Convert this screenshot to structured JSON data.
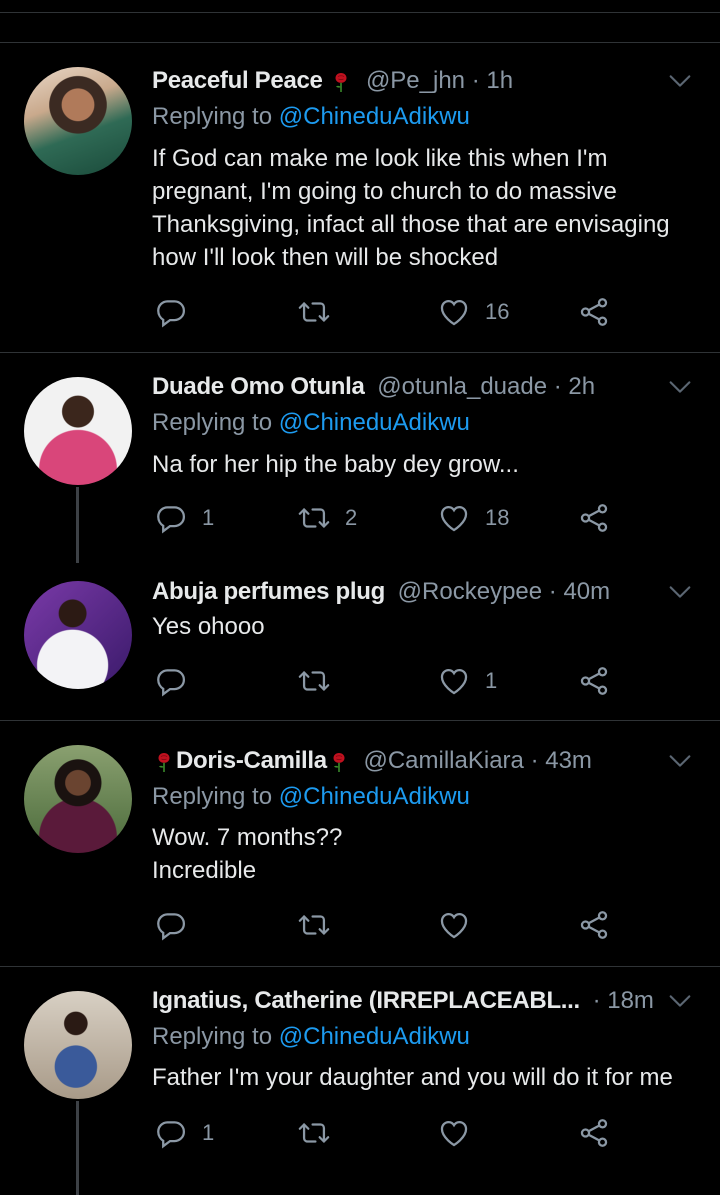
{
  "reply_prefix": "Replying to ",
  "tweets": [
    {
      "name": "Peaceful Peace",
      "handle": "@Pe_jhn",
      "time": "· 1h",
      "reply_to": "@ChineduAdikwu",
      "text": "If God can make me look like this when I'm\npregnant, I'm going to church to do massive\nThanksgiving, infact all those that are envisaging\nhow I'll look then will be shocked",
      "replies": "",
      "retweets": "",
      "likes": "16"
    },
    {
      "name": "Duade Omo Otunla",
      "handle": "@otunla_duade",
      "time": "· 2h",
      "reply_to": "@ChineduAdikwu",
      "text": "Na for her hip the baby dey grow...",
      "replies": "1",
      "retweets": "2",
      "likes": "18"
    },
    {
      "name": "Abuja perfumes plug",
      "handle": "@Rockeypee",
      "time": "· 40m",
      "text": "Yes ohooo",
      "replies": "",
      "retweets": "",
      "likes": "1"
    },
    {
      "name": "Doris-Camilla",
      "handle": "@CamillaKiara",
      "time": "· 43m",
      "reply_to": "@ChineduAdikwu",
      "text": "Wow. 7 months??\nIncredible",
      "replies": "",
      "retweets": "",
      "likes": ""
    },
    {
      "name": "Ignatius, Catherine (IRREPLACEABL...",
      "handle": "",
      "time": "· 18m",
      "reply_to": "@ChineduAdikwu",
      "text": "Father I'm your daughter and you will do it for me",
      "replies": "1",
      "retweets": "",
      "likes": ""
    }
  ],
  "colors": {
    "background": "#000000",
    "secondary_text": "#8b98a5",
    "mention": "#1d9bf0",
    "divider": "#2f3336",
    "rose": "#c0111f"
  },
  "icons": [
    "reply-icon",
    "retweet-icon",
    "like-icon",
    "share-icon",
    "chevron-down-icon",
    "rose-emoji"
  ]
}
